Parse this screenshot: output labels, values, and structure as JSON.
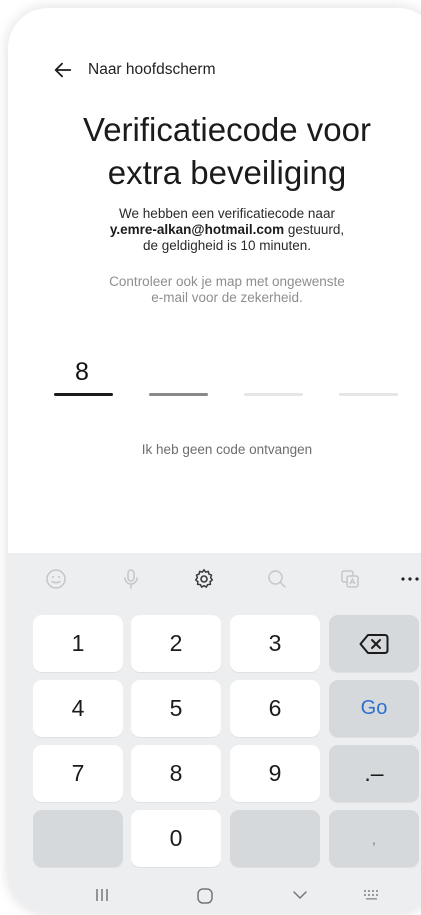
{
  "header": {
    "back_label": "Naar hoofdscherm"
  },
  "title": {
    "line1": "Verificatiecode voor",
    "line2": "extra beveiliging"
  },
  "description": {
    "line1": "We hebben een verificatiecode naar",
    "email": "y.emre-alkan@hotmail.com",
    "line2_suffix": " gestuurd,",
    "line3": "de geldigheid is 10 minuten."
  },
  "hint": {
    "line1": "Controleer ook je map met ongewenste",
    "line2": "e-mail voor de zekerheid."
  },
  "code": {
    "digits": [
      "8",
      "",
      "",
      ""
    ]
  },
  "no_code_link": "Ik heb geen code ontvangen",
  "keyboard": {
    "rows": [
      [
        "1",
        "2",
        "3",
        "⌫"
      ],
      [
        "4",
        "5",
        "6",
        "Go"
      ],
      [
        "7",
        "8",
        "9",
        ".–"
      ],
      [
        "",
        "0",
        "",
        ","
      ]
    ]
  },
  "colors": {
    "accent": "#2f6fd0",
    "active_bar": "#1b1b1b",
    "next_bar": "#8a8a8a",
    "idle_bar": "#e6e6e6"
  }
}
